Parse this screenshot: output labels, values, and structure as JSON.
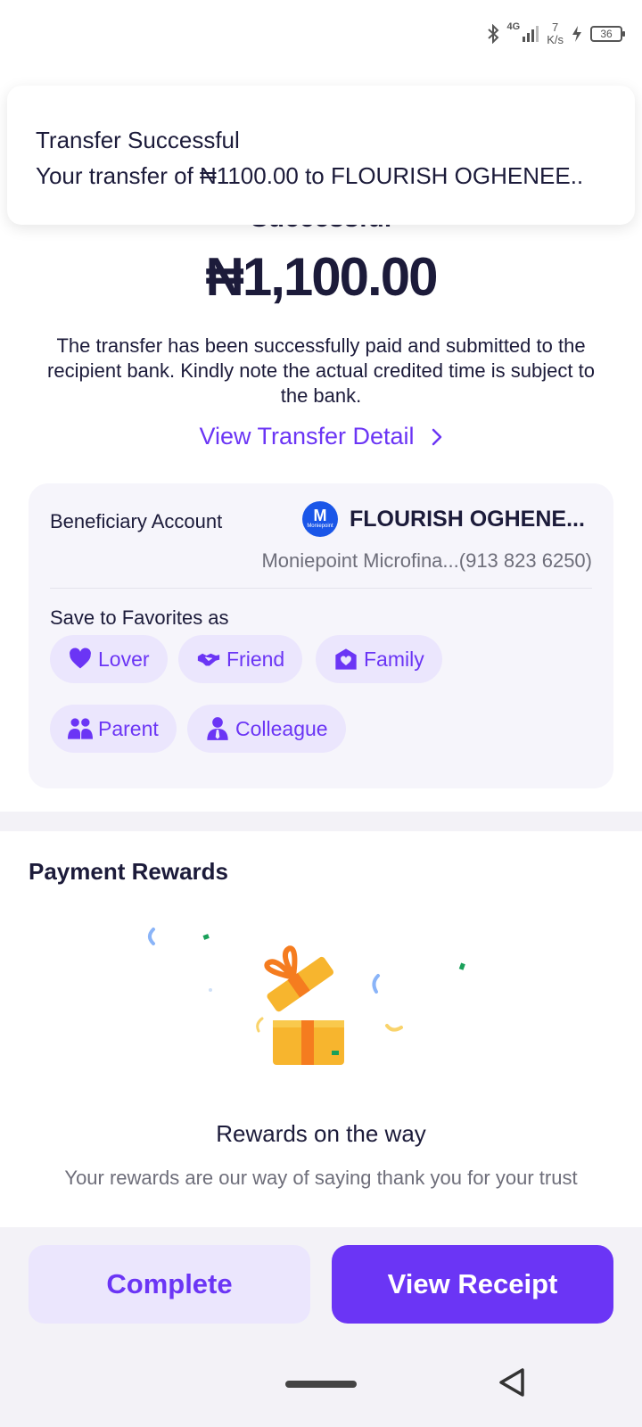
{
  "status_bar": {
    "network": "4G",
    "speed_value": "7",
    "speed_unit": "K/s",
    "battery": "36"
  },
  "toast": {
    "title": "Transfer Successful",
    "message": "Your transfer of ₦1100.00 to FLOURISH OGHENEE.."
  },
  "header": {
    "status_text": "Successful",
    "amount": "₦1,100.00",
    "description": "The transfer has been successfully paid and submitted to the recipient bank. Kindly note the actual credited time is subject to the bank.",
    "detail_link": "View Transfer Detail"
  },
  "beneficiary": {
    "label": "Beneficiary Account",
    "logo_letter": "M",
    "logo_text": "Moniepoint",
    "name": "FLOURISH OGHENE...",
    "bank": "Moniepoint Microfina...(913 823 6250)"
  },
  "favorites": {
    "label": "Save to Favorites as",
    "options": [
      {
        "label": "Lover",
        "icon": "heart-icon"
      },
      {
        "label": "Friend",
        "icon": "handshake-icon"
      },
      {
        "label": "Family",
        "icon": "family-heart-icon"
      },
      {
        "label": "Parent",
        "icon": "parent-icon"
      },
      {
        "label": "Colleague",
        "icon": "colleague-icon"
      }
    ]
  },
  "rewards": {
    "title": "Payment Rewards",
    "subtitle": "Rewards on the way",
    "text": "Your rewards are our way of saying thank you for your trust"
  },
  "actions": {
    "complete": "Complete",
    "view_receipt": "View Receipt"
  },
  "colors": {
    "accent": "#6b35f5",
    "accent_light": "#ebe6fd",
    "text_dark": "#1c1b3a",
    "bank_logo": "#1a56e8"
  }
}
